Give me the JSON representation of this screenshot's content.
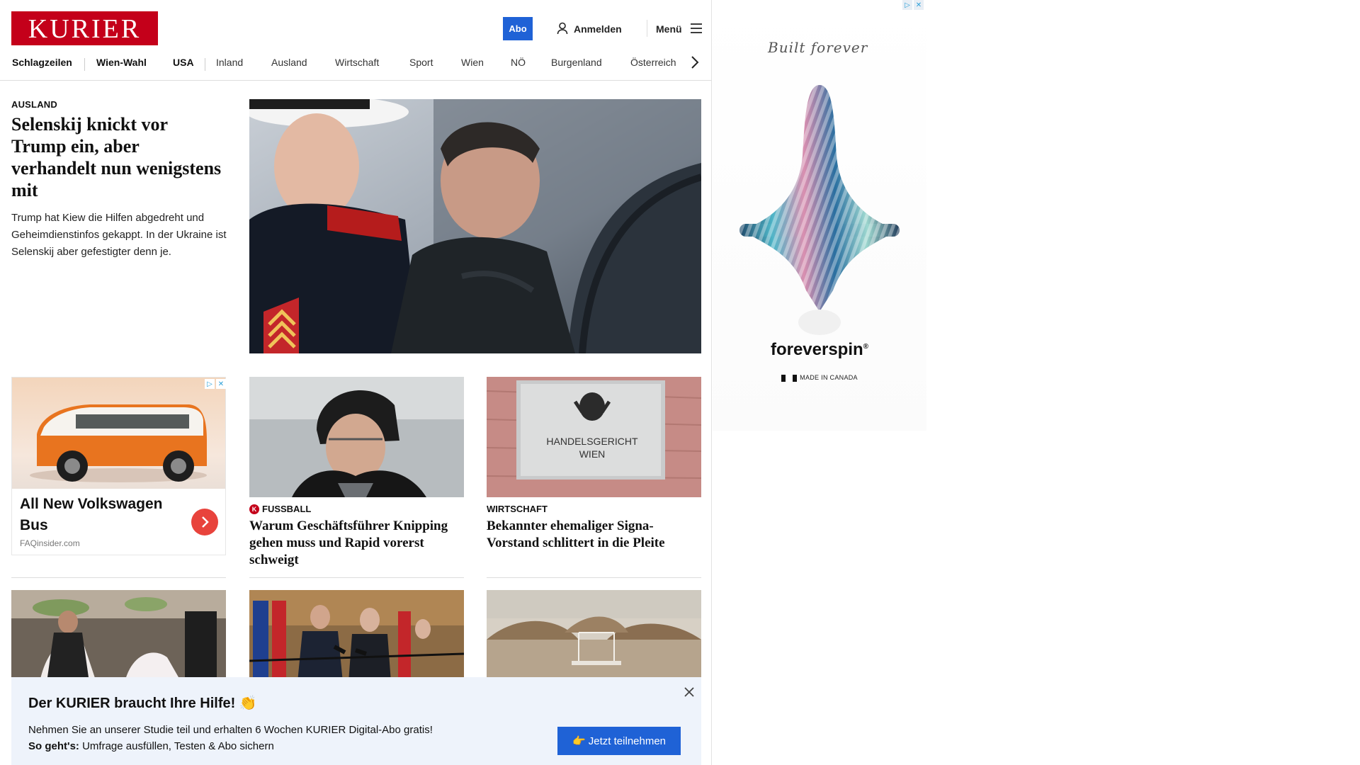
{
  "header": {
    "logo_text": "KURIER",
    "abo_label": "Abo",
    "login_label": "Anmelden",
    "menu_label": "Menü",
    "brand_color": "#c4001a",
    "accent_color": "#1f62d6"
  },
  "nav": {
    "items": [
      {
        "label": "Schlagzeilen"
      },
      {
        "label": "Wien-Wahl"
      },
      {
        "label": "USA"
      },
      {
        "label": "Inland"
      },
      {
        "label": "Ausland"
      },
      {
        "label": "Wirtschaft"
      },
      {
        "label": "Sport"
      },
      {
        "label": "Wien"
      },
      {
        "label": "NÖ"
      },
      {
        "label": "Burgenland"
      },
      {
        "label": "Österreich"
      }
    ]
  },
  "lead": {
    "kicker": "AUSLAND",
    "title": "Selenskij knickt vor Trump ein, aber verhandelt nun wenigstens mit",
    "teaser": "Trump hat Kiew die Hilfen abgedreht und Geheimdienstinfos gekappt. In der Ukraine ist Selenskij aber gefestigter denn je."
  },
  "sponsored": {
    "title": "All New Volkswagen Bus",
    "source": "FAQinsider.com"
  },
  "cards": [
    {
      "kicker": "FUSSBALL",
      "title": "Warum Geschäftsführer Knipping gehen muss und Rapid vorerst schweigt",
      "premium": "K"
    },
    {
      "kicker": "WIRTSCHAFT",
      "title": "Bekannter ehemaliger Signa-Vorstand schlittert in die Pleite",
      "sign_line1": "HANDELSGERICHT",
      "sign_line2": "WIEN"
    }
  ],
  "popup": {
    "title": "Der KURIER braucht Ihre Hilfe! 👏",
    "text1": "Nehmen Sie an unserer Studie teil und erhalten 6 Wochen KURIER Digital-Abo gratis!",
    "text2_bold": "So geht's:",
    "text2_rest": " Umfrage ausfüllen, Testen & Abo sichern",
    "cta": "👉 Jetzt teilnehmen"
  },
  "side_ad": {
    "tagline": "Built forever",
    "brand": "foreverspin",
    "reg": "®",
    "made_in": "MADE IN CANADA"
  }
}
